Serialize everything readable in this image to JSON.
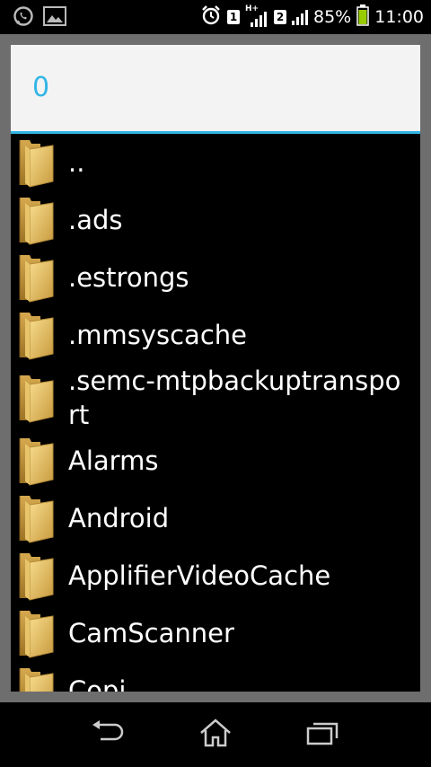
{
  "status_bar": {
    "battery_percent": "85%",
    "time": "11:00",
    "sim1": "1",
    "sim2": "2",
    "network_type": "H+",
    "icons": [
      "whatsapp-icon",
      "image-icon",
      "alarm-icon",
      "signal-icon",
      "battery-icon"
    ]
  },
  "dialog": {
    "title": "0",
    "accent_color": "#33b5e5",
    "items": [
      {
        "label": ".."
      },
      {
        "label": ".ads"
      },
      {
        "label": ".estrongs"
      },
      {
        "label": ".mmsyscache"
      },
      {
        "label": ".semc-mtpbackuptransport"
      },
      {
        "label": "Alarms"
      },
      {
        "label": "Android"
      },
      {
        "label": "ApplifierVideoCache"
      },
      {
        "label": "CamScanner"
      },
      {
        "label": "Copi..."
      }
    ]
  },
  "nav_bar": {
    "icons": [
      "back-icon",
      "home-icon",
      "recent-apps-icon"
    ]
  }
}
